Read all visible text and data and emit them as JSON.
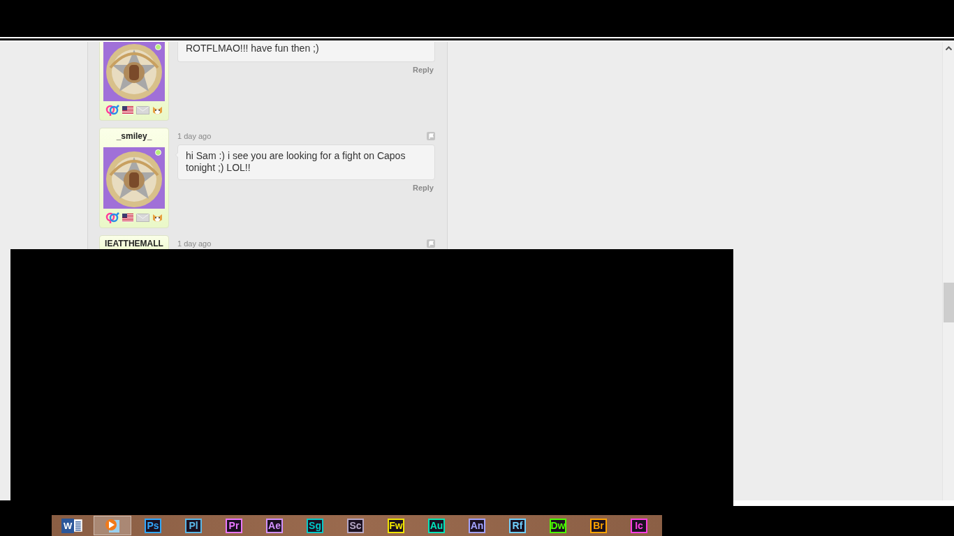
{
  "comments": [
    {
      "online": true,
      "text": "ROTFLMAO!!! have fun then ;)",
      "reply": "Reply"
    },
    {
      "username": "_smiley_",
      "timestamp": "1 day ago",
      "online": true,
      "text": "hi Sam :) i see you are looking for a fight on Capos tonight ;) LOL!!",
      "reply": "Reply"
    },
    {
      "username": "IEATTHEMALL",
      "timestamp": "1 day ago"
    }
  ],
  "taskbar": [
    {
      "kind": "word",
      "label": "W",
      "selected": false
    },
    {
      "kind": "player",
      "selected": true
    },
    {
      "kind": "adobe",
      "label": "Ps",
      "color": "#31a8ff",
      "selected": false
    },
    {
      "kind": "adobe",
      "label": "Pl",
      "color": "#5bb8e8",
      "selected": false
    },
    {
      "kind": "adobe",
      "label": "Pr",
      "color": "#ea77ff",
      "selected": false
    },
    {
      "kind": "adobe",
      "label": "Ae",
      "color": "#d291ff",
      "selected": false
    },
    {
      "kind": "adobe",
      "label": "Sg",
      "color": "#00c8c8",
      "selected": false
    },
    {
      "kind": "adobe",
      "label": "Sc",
      "color": "#b7a9c7",
      "selected": false
    },
    {
      "kind": "adobe",
      "label": "Fw",
      "color": "#f2e600",
      "selected": false
    },
    {
      "kind": "adobe",
      "label": "Au",
      "color": "#00e4bb",
      "selected": false
    },
    {
      "kind": "adobe",
      "label": "An",
      "color": "#a3a3ff",
      "selected": false
    },
    {
      "kind": "adobe",
      "label": "Rf",
      "color": "#6fd0ff",
      "selected": false
    },
    {
      "kind": "adobe",
      "label": "Dw",
      "color": "#4cff00",
      "selected": false
    },
    {
      "kind": "adobe",
      "label": "Br",
      "color": "#ffa400",
      "selected": false
    },
    {
      "kind": "adobe",
      "label": "Ic",
      "color": "#ff3ee5",
      "selected": false
    }
  ]
}
